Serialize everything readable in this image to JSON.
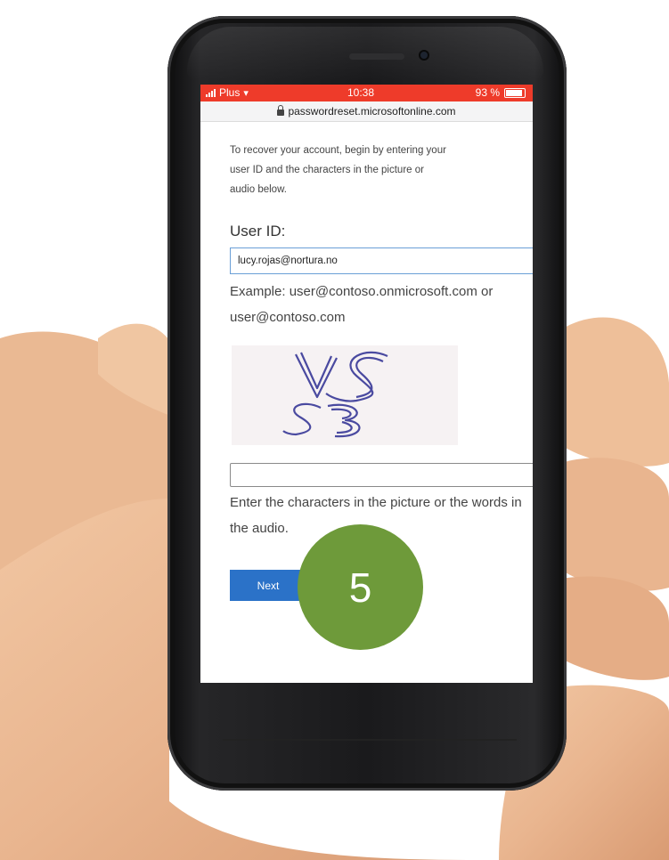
{
  "status_bar": {
    "carrier": "Plus",
    "time": "10:38",
    "battery": "93 %"
  },
  "browser": {
    "url": "passwordreset.microsoftonline.com"
  },
  "form": {
    "intro_line1": "To recover your account, begin by entering your",
    "intro_line2": "user ID and the characters in the picture or",
    "intro_line3": "audio below.",
    "userid_label": "User ID:",
    "userid_value": "lucy.rojas@nortura.no",
    "example_line1": "Example: user@contoso.onmicrosoft.com or",
    "example_line2": "user@contoso.com",
    "captcha_text": "VS S3",
    "captcha_value": "",
    "captcha_help_line1": "Enter the characters in the picture or the words in",
    "captcha_help_line2": "the audio.",
    "next_label": "Next"
  },
  "step_badge": {
    "number": "5",
    "color": "#6e9a3a"
  },
  "colors": {
    "status_bar": "#ee3b2a",
    "button": "#2b72c8",
    "input_focus": "#6a9fd6"
  }
}
